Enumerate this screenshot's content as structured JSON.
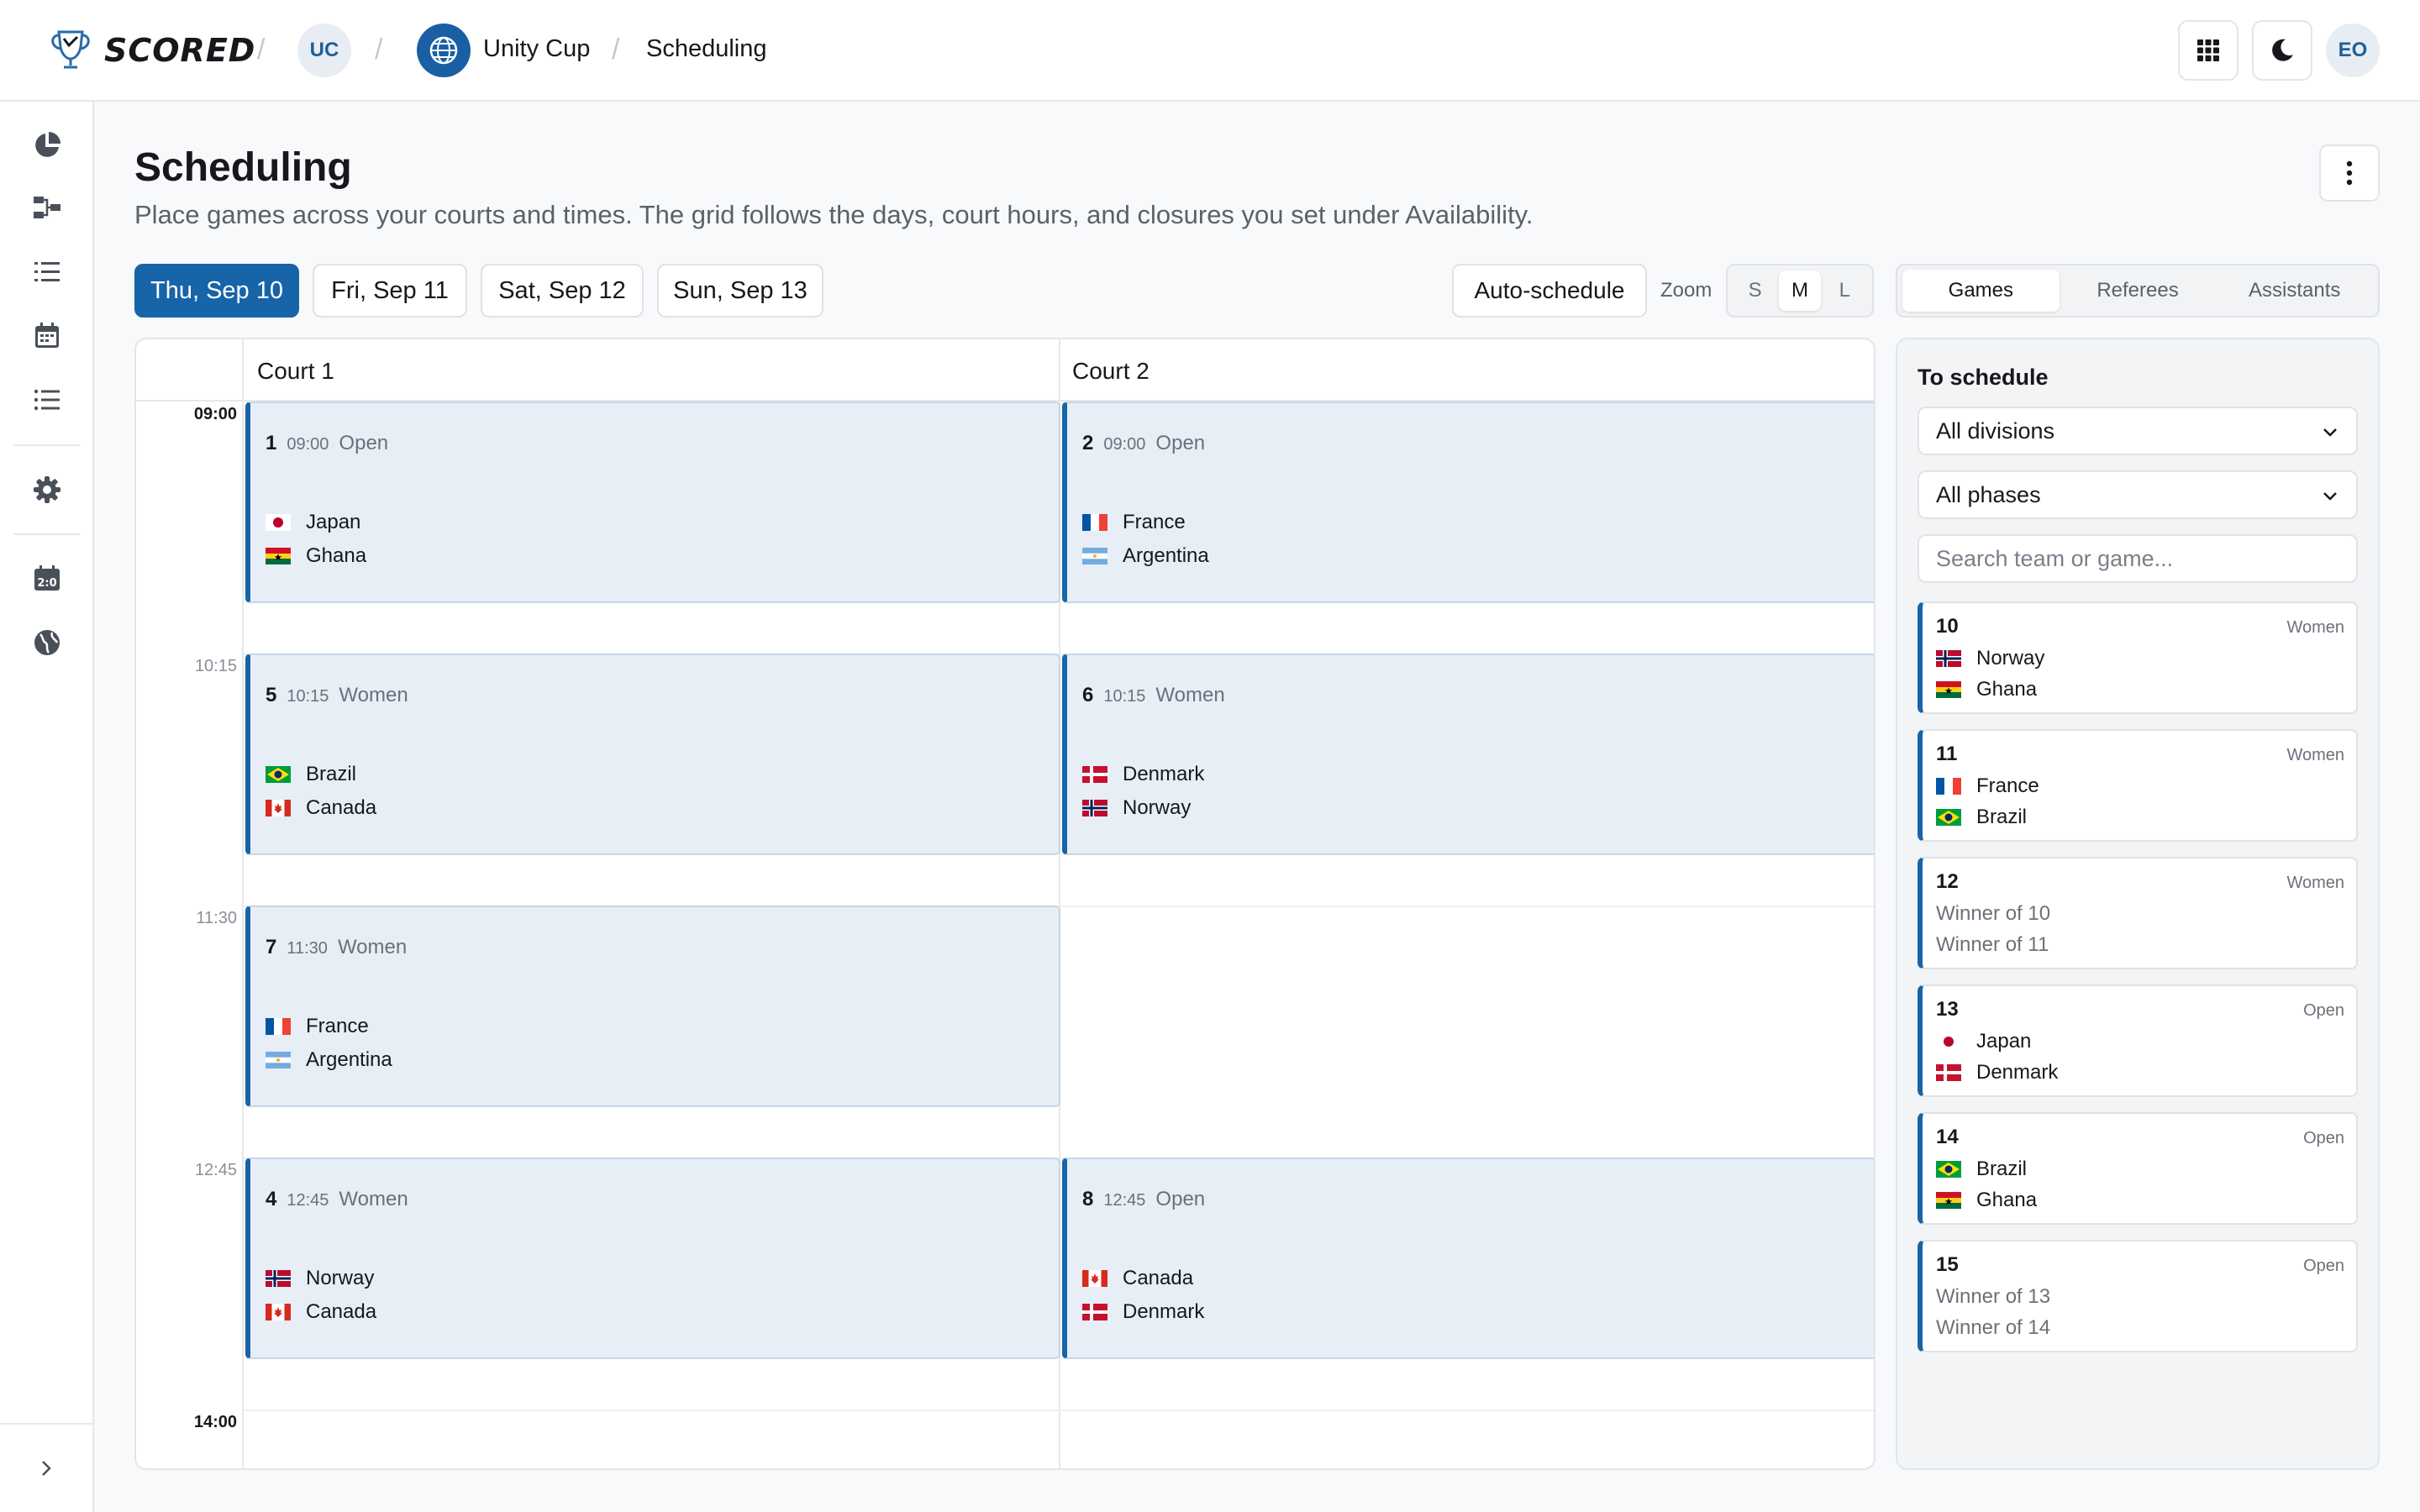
{
  "app": {
    "brand": "SCORED",
    "org_initials": "UC",
    "tournament": "Unity Cup",
    "page": "Scheduling",
    "user_initials": "EO"
  },
  "header": {
    "title": "Scheduling",
    "subtitle": "Place games across your courts and times. The grid follows the days, court hours, and closures you set under Availability."
  },
  "days": [
    {
      "label": "Thu, Sep 10",
      "active": true
    },
    {
      "label": "Fri, Sep 11",
      "active": false
    },
    {
      "label": "Sat, Sep 12",
      "active": false
    },
    {
      "label": "Sun, Sep 13",
      "active": false
    }
  ],
  "toolbar": {
    "auto_schedule": "Auto-schedule",
    "zoom_label": "Zoom",
    "zoom_options": [
      "S",
      "M",
      "L"
    ],
    "zoom_selected": "M"
  },
  "panel_tabs": [
    {
      "label": "Games",
      "active": true
    },
    {
      "label": "Referees",
      "active": false
    },
    {
      "label": "Assistants",
      "active": false
    }
  ],
  "grid": {
    "courts": [
      "Court 1",
      "Court 2"
    ],
    "times": [
      {
        "label": "09:00",
        "major": true
      },
      {
        "label": "10:15",
        "major": false
      },
      {
        "label": "11:30",
        "major": false
      },
      {
        "label": "12:45",
        "major": false
      },
      {
        "label": "14:00",
        "major": true
      }
    ],
    "games": [
      {
        "court": 0,
        "slot": 0,
        "num": "1",
        "time": "09:00",
        "division": "Open",
        "teams": [
          "Japan",
          "Ghana"
        ]
      },
      {
        "court": 1,
        "slot": 0,
        "num": "2",
        "time": "09:00",
        "division": "Open",
        "teams": [
          "France",
          "Argentina"
        ]
      },
      {
        "court": 0,
        "slot": 1,
        "num": "5",
        "time": "10:15",
        "division": "Women",
        "teams": [
          "Brazil",
          "Canada"
        ]
      },
      {
        "court": 1,
        "slot": 1,
        "num": "6",
        "time": "10:15",
        "division": "Women",
        "teams": [
          "Denmark",
          "Norway"
        ]
      },
      {
        "court": 0,
        "slot": 2,
        "num": "7",
        "time": "11:30",
        "division": "Women",
        "teams": [
          "France",
          "Argentina"
        ]
      },
      {
        "court": 0,
        "slot": 3,
        "num": "4",
        "time": "12:45",
        "division": "Women",
        "teams": [
          "Norway",
          "Canada"
        ]
      },
      {
        "court": 1,
        "slot": 3,
        "num": "8",
        "time": "12:45",
        "division": "Open",
        "teams": [
          "Canada",
          "Denmark"
        ]
      }
    ]
  },
  "to_schedule": {
    "title": "To schedule",
    "division_filter": "All divisions",
    "phase_filter": "All phases",
    "search_placeholder": "Search team or game...",
    "games": [
      {
        "num": "10",
        "division": "Women",
        "teams": [
          "Norway",
          "Ghana"
        ]
      },
      {
        "num": "11",
        "division": "Women",
        "teams": [
          "France",
          "Brazil"
        ]
      },
      {
        "num": "12",
        "division": "Women",
        "teams": [
          "Winner of 10",
          "Winner of 11"
        ]
      },
      {
        "num": "13",
        "division": "Open",
        "teams": [
          "Japan",
          "Denmark"
        ]
      },
      {
        "num": "14",
        "division": "Open",
        "teams": [
          "Brazil",
          "Ghana"
        ]
      },
      {
        "num": "15",
        "division": "Open",
        "teams": [
          "Winner of 13",
          "Winner of 14"
        ]
      }
    ]
  },
  "icons": {
    "sidebar": [
      "pie-chart-icon",
      "bracket-icon",
      "list-numbered-icon",
      "calendar-icon",
      "list-icon",
      "gear-icon",
      "scoreboard-icon",
      "globe-icon"
    ],
    "top_right": [
      "apps-grid-icon",
      "moon-icon"
    ]
  },
  "colors": {
    "accent": "#1864a8",
    "game_bg": "#e7eef6"
  }
}
